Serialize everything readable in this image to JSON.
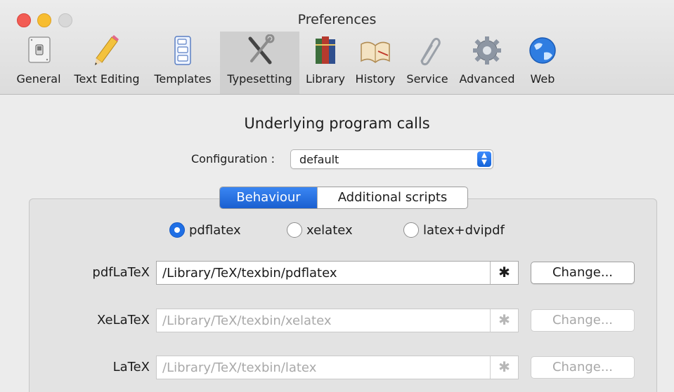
{
  "window": {
    "title": "Preferences"
  },
  "toolbar": {
    "items": [
      {
        "label": "General",
        "icon": "light-switch-icon"
      },
      {
        "label": "Text Editing",
        "icon": "pencil-icon"
      },
      {
        "label": "Templates",
        "icon": "template-icon"
      },
      {
        "label": "Typesetting",
        "icon": "tools-icon"
      },
      {
        "label": "Library",
        "icon": "books-icon"
      },
      {
        "label": "History",
        "icon": "book-icon"
      },
      {
        "label": "Service",
        "icon": "paperclip-icon"
      },
      {
        "label": "Advanced",
        "icon": "gear-icon"
      },
      {
        "label": "Web",
        "icon": "globe-icon"
      }
    ],
    "selected": "Typesetting"
  },
  "main": {
    "section_title": "Underlying program calls",
    "configuration": {
      "label": "Configuration :",
      "value": "default"
    },
    "tabs": [
      {
        "label": "Behaviour",
        "selected": true
      },
      {
        "label": "Additional scripts",
        "selected": false
      }
    ],
    "engines": [
      {
        "label": "pdflatex",
        "checked": true
      },
      {
        "label": "xelatex",
        "checked": false
      },
      {
        "label": "latex+dvipdf",
        "checked": false
      }
    ],
    "programs": [
      {
        "label": "pdfLaTeX",
        "path": "/Library/TeX/texbin/pdflatex",
        "button": "Change...",
        "enabled": true
      },
      {
        "label": "XeLaTeX",
        "path": "/Library/TeX/texbin/xelatex",
        "button": "Change...",
        "enabled": false
      },
      {
        "label": "LaTeX",
        "path": "/Library/TeX/texbin/latex",
        "button": "Change...",
        "enabled": false
      }
    ]
  },
  "colors": {
    "accent": "#1f6fe5",
    "toolbar_bg": "#dcdcdc",
    "selected_tool": "#cfcfcf"
  }
}
